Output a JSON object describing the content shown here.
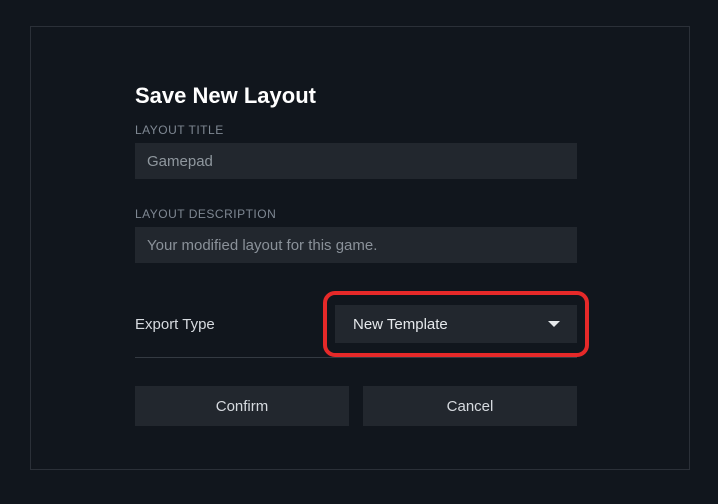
{
  "dialog": {
    "title": "Save New Layout",
    "layout_title_label": "LAYOUT TITLE",
    "layout_title_value": "Gamepad",
    "layout_desc_label": "LAYOUT DESCRIPTION",
    "layout_desc_placeholder": "Your modified layout for this game.",
    "export_type_label": "Export Type",
    "export_type_selected": "New Template",
    "confirm_label": "Confirm",
    "cancel_label": "Cancel"
  }
}
